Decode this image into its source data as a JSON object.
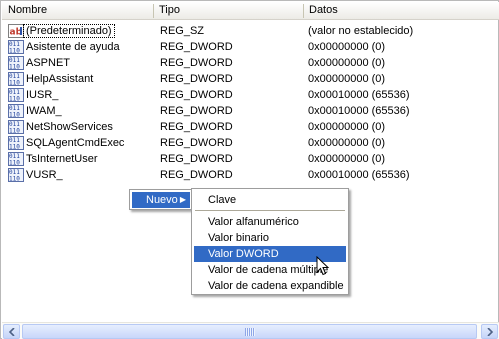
{
  "columns": {
    "name": "Nombre",
    "type": "Tipo",
    "data": "Datos"
  },
  "rows": [
    {
      "icon": "string-value-icon",
      "name": "(Predeterminado)",
      "type": "REG_SZ",
      "data": "(valor no establecido)"
    },
    {
      "icon": "binary-value-icon",
      "name": "Asistente de ayuda",
      "type": "REG_DWORD",
      "data": "0x00000000 (0)"
    },
    {
      "icon": "binary-value-icon",
      "name": "ASPNET",
      "type": "REG_DWORD",
      "data": "0x00000000 (0)"
    },
    {
      "icon": "binary-value-icon",
      "name": "HelpAssistant",
      "type": "REG_DWORD",
      "data": "0x00000000 (0)"
    },
    {
      "icon": "binary-value-icon",
      "name": "IUSR_",
      "type": "REG_DWORD",
      "data": "0x00010000 (65536)"
    },
    {
      "icon": "binary-value-icon",
      "name": "IWAM_",
      "type": "REG_DWORD",
      "data": "0x00010000 (65536)"
    },
    {
      "icon": "binary-value-icon",
      "name": "NetShowServices",
      "type": "REG_DWORD",
      "data": "0x00000000 (0)"
    },
    {
      "icon": "binary-value-icon",
      "name": "SQLAgentCmdExec",
      "type": "REG_DWORD",
      "data": "0x00000000 (0)"
    },
    {
      "icon": "binary-value-icon",
      "name": "TsInternetUser",
      "type": "REG_DWORD",
      "data": "0x00000000 (0)"
    },
    {
      "icon": "binary-value-icon",
      "name": "VUSR_",
      "type": "REG_DWORD",
      "data": "0x00010000 (65536)"
    }
  ],
  "context_menu": {
    "label": "Nuevo",
    "arrow_icon": "submenu-arrow-icon"
  },
  "submenu": {
    "items": [
      {
        "label": "Clave",
        "selected": false
      },
      {
        "label": "Valor alfanumérico",
        "selected": false
      },
      {
        "label": "Valor binario",
        "selected": false
      },
      {
        "label": "Valor DWORD",
        "selected": true
      },
      {
        "label": "Valor de cadena múltiple",
        "selected": false
      },
      {
        "label": "Valor de cadena expandible",
        "selected": false
      }
    ]
  },
  "colors": {
    "selection": "#316ac5",
    "menu_border": "#9d9d9d",
    "header_bg": "#ecebe6"
  }
}
